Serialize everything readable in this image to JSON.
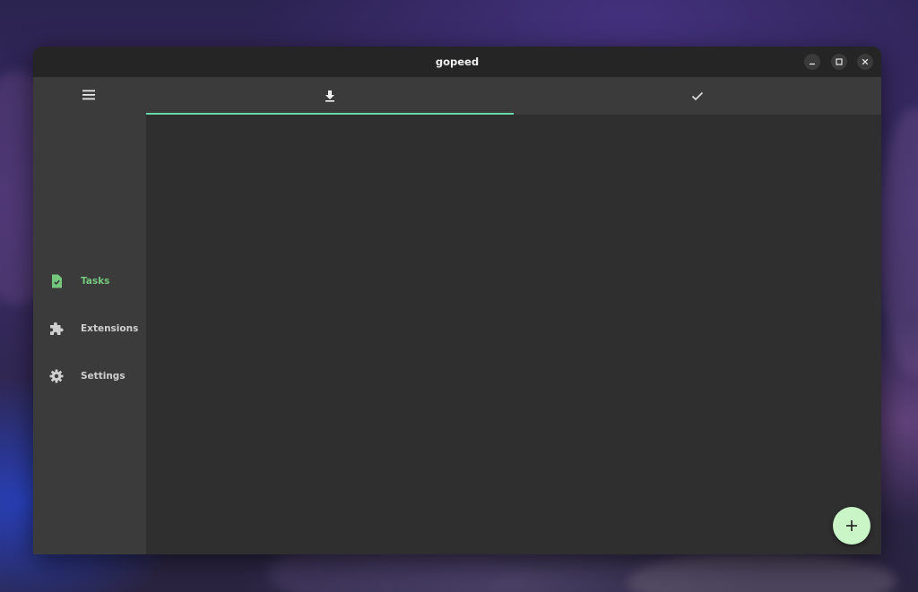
{
  "window": {
    "title": "gopeed",
    "controls": [
      "minimize-icon",
      "maximize-icon",
      "close-icon"
    ]
  },
  "sidebar": {
    "menu_icon": "menu-icon",
    "items": [
      {
        "label": "Tasks",
        "icon": "task-file-icon",
        "active": true
      },
      {
        "label": "Extensions",
        "icon": "puzzle-icon",
        "active": false
      },
      {
        "label": "Settings",
        "icon": "gear-icon",
        "active": false
      }
    ]
  },
  "tabs": [
    {
      "icon": "download-icon",
      "selected": true
    },
    {
      "icon": "check-icon",
      "selected": false
    }
  ],
  "fab": {
    "icon": "plus-icon"
  },
  "colors": {
    "accent_green": "#74c87d",
    "tab_indicator": "#66d9a8",
    "fab_background": "#c9f5c7",
    "sidebar_background": "#3b3b3b",
    "content_background": "#2f2f2f",
    "titlebar_background": "#252525"
  }
}
